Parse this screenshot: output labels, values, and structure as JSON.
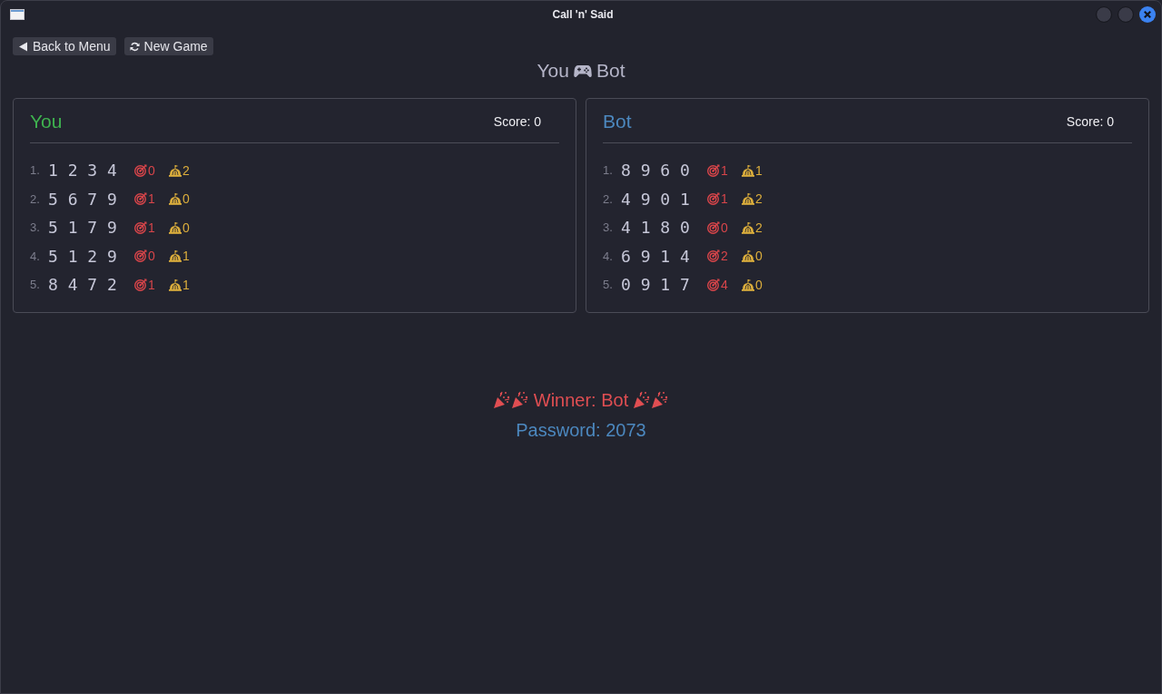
{
  "window": {
    "title": "Call 'n' Said"
  },
  "toolbar": {
    "buttons": [
      {
        "label": "Back to Menu",
        "kind": "back"
      },
      {
        "label": "New Game",
        "kind": "restart"
      }
    ]
  },
  "heading": {
    "left": "You",
    "right": "Bot"
  },
  "boards": [
    {
      "player": "You",
      "color": "#3fb34f",
      "score": "Score: 0",
      "guesses": [
        {
          "number": "1.",
          "digits": "1 2 3 4",
          "hits": "0",
          "blows": "2"
        },
        {
          "number": "2.",
          "digits": "5 6 7 9",
          "hits": "1",
          "blows": "0"
        },
        {
          "number": "3.",
          "digits": "5 1 7 9",
          "hits": "1",
          "blows": "0"
        },
        {
          "number": "4.",
          "digits": "5 1 2 9",
          "hits": "0",
          "blows": "1"
        },
        {
          "number": "5.",
          "digits": "8 4 7 2",
          "hits": "1",
          "blows": "1"
        }
      ]
    },
    {
      "player": "Bot",
      "color": "#4c88bf",
      "score": "Score: 0",
      "guesses": [
        {
          "number": "1.",
          "digits": "8 9 6 0",
          "hits": "1",
          "blows": "1"
        },
        {
          "number": "2.",
          "digits": "4 9 0 1",
          "hits": "1",
          "blows": "2"
        },
        {
          "number": "3.",
          "digits": "4 1 8 0",
          "hits": "0",
          "blows": "2"
        },
        {
          "number": "4.",
          "digits": "6 9 1 4",
          "hits": "2",
          "blows": "0"
        },
        {
          "number": "5.",
          "digits": "0 9 1 7",
          "hits": "4",
          "blows": "0"
        }
      ]
    }
  ],
  "result": {
    "winner": "Winner: Bot",
    "password": "Password: 2073"
  }
}
